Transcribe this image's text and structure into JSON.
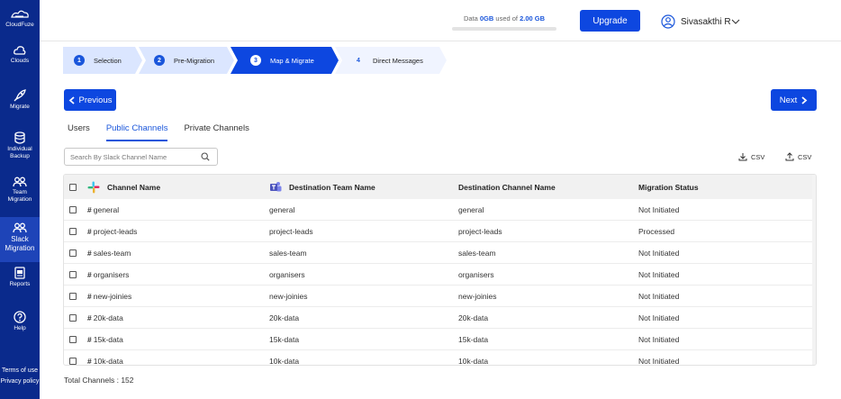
{
  "sidebar": {
    "brand": "CloudFuze",
    "items": [
      {
        "label": "Clouds",
        "icon": "cloud-icon"
      },
      {
        "label": "Migrate",
        "icon": "rocket-icon"
      },
      {
        "label": "Individual Backup",
        "label_lines": [
          "Individual",
          "Backup"
        ],
        "icon": "database-icon"
      },
      {
        "label": "Team Migration",
        "label_lines": [
          "Team",
          "Migration"
        ],
        "icon": "team-icon"
      },
      {
        "label": "Slack Migration",
        "label_lines": [
          "Slack",
          "Migration"
        ],
        "icon": "slack-team-icon",
        "active": true
      },
      {
        "label": "Reports",
        "icon": "report-icon"
      },
      {
        "label": "Help",
        "icon": "help-icon"
      }
    ],
    "terms": "Terms of use",
    "privacy": "Privacy policy"
  },
  "header": {
    "data_prefix": "Data",
    "data_used": "0GB",
    "data_mid": "used of",
    "data_total": "2.00 GB",
    "usage_fraction": 0,
    "upgrade_label": "Upgrade",
    "user_name": "Sivasakthi R"
  },
  "steps": [
    {
      "num": "1",
      "label": "Selection",
      "state": "done"
    },
    {
      "num": "2",
      "label": "Pre-Migration",
      "state": "done"
    },
    {
      "num": "3",
      "label": "Map & Migrate",
      "state": "active"
    },
    {
      "num": "4",
      "label": "Direct Messages",
      "state": "pending"
    }
  ],
  "nav": {
    "previous_label": "Previous",
    "next_label": "Next"
  },
  "tabs": [
    {
      "label": "Users",
      "active": false
    },
    {
      "label": "Public Channels",
      "active": true
    },
    {
      "label": "Private Channels",
      "active": false
    }
  ],
  "search": {
    "placeholder": "Search By Slack Channel Name"
  },
  "csv": {
    "download_label": "CSV",
    "upload_label": "CSV"
  },
  "table": {
    "headers": {
      "channel": "Channel Name",
      "dest_team": "Destination Team Name",
      "dest_channel": "Destination Channel Name",
      "status": "Migration Status"
    },
    "rows": [
      {
        "channel": "general",
        "team": "general",
        "dest": "general",
        "status": "Not Initiated"
      },
      {
        "channel": "project-leads",
        "team": "project-leads",
        "dest": "project-leads",
        "status": "Processed"
      },
      {
        "channel": "sales-team",
        "team": "sales-team",
        "dest": "sales-team",
        "status": "Not Initiated"
      },
      {
        "channel": "organisers",
        "team": "organisers",
        "dest": "organisers",
        "status": "Not Initiated"
      },
      {
        "channel": "new-joinies",
        "team": "new-joinies",
        "dest": "new-joinies",
        "status": "Not Initiated"
      },
      {
        "channel": "20k-data",
        "team": "20k-data",
        "dest": "20k-data",
        "status": "Not Initiated"
      },
      {
        "channel": "15k-data",
        "team": "15k-data",
        "dest": "15k-data",
        "status": "Not Initiated"
      },
      {
        "channel": "10k-data",
        "team": "10k-data",
        "dest": "10k-data",
        "status": "Not Initiated"
      }
    ]
  },
  "footer": {
    "total_label": "Total Channels : 152"
  },
  "colors": {
    "sidebar": "#0a2a8c",
    "accent": "#0d47e0",
    "step_done": "#dbe6ff",
    "step_active": "#0d47e0"
  }
}
